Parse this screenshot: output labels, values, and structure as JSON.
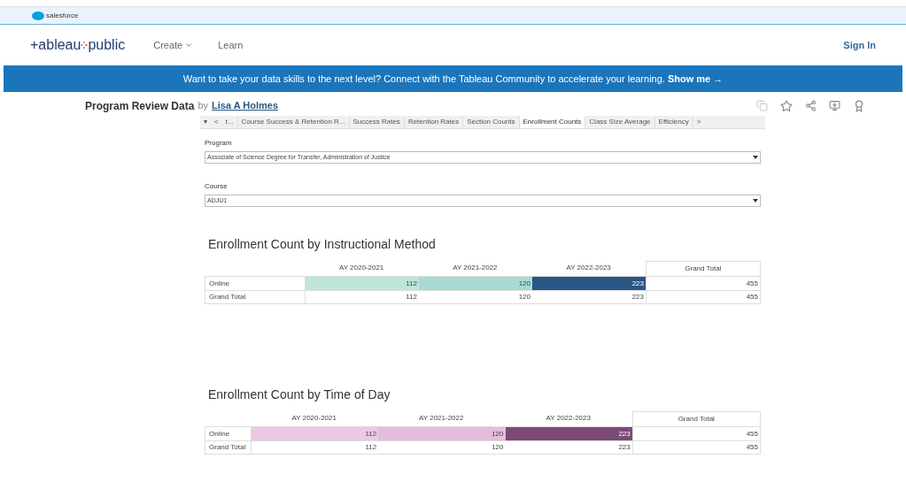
{
  "top_bar": {
    "brand": "salesforce"
  },
  "nav": {
    "logo_left": "+ableau",
    "logo_right": "public",
    "items": [
      {
        "label": "Create",
        "kind": "dropdown"
      },
      {
        "label": "Learn",
        "kind": "link"
      }
    ],
    "sign_in": "Sign In"
  },
  "banner": {
    "text": "Want to take your data skills to the next level? Connect with the Tableau Community to accelerate your learning.",
    "link": "Show me →"
  },
  "viz": {
    "title": "Program Review Data",
    "by": "by",
    "author": "Lisa A Holmes"
  },
  "tabs": [
    {
      "label": "▾",
      "selected": false,
      "kind": "control"
    },
    {
      "label": "<",
      "selected": false,
      "kind": "control"
    },
    {
      "label": "t...",
      "selected": false,
      "kind": "tab"
    },
    {
      "label": "Course Success & Retention R...",
      "selected": false,
      "kind": "tab"
    },
    {
      "label": "Success Rates",
      "selected": false,
      "kind": "tab"
    },
    {
      "label": "Retention Rates",
      "selected": false,
      "kind": "tab"
    },
    {
      "label": "Section Counts",
      "selected": false,
      "kind": "tab"
    },
    {
      "label": "Enrollment Counts",
      "selected": true,
      "kind": "tab"
    },
    {
      "label": "Class Size Average",
      "selected": false,
      "kind": "tab"
    },
    {
      "label": "Efficiency",
      "selected": false,
      "kind": "tab"
    },
    {
      "label": ">",
      "selected": false,
      "kind": "control"
    }
  ],
  "filters": [
    {
      "label": "Program",
      "value": "Associate of Science Degree for Transfer, Administration of Justice"
    },
    {
      "label": "Course",
      "value": "ADJU1"
    }
  ],
  "tables": [
    {
      "title": "Enrollment Count by Instructional Method",
      "columns": [
        "AY 2020-2021",
        "AY 2021-2022",
        "AY 2022-2023",
        "Grand Total"
      ],
      "rows": [
        {
          "label": "Online",
          "cells": [
            {
              "text": "112",
              "color": "#bfe5da"
            },
            {
              "text": "120",
              "color": "#a8dad3"
            },
            {
              "text": "223",
              "color": "#2a5783"
            },
            {
              "text": "455"
            }
          ]
        },
        {
          "label": "Grand Total",
          "cells": [
            {
              "text": "112"
            },
            {
              "text": "120"
            },
            {
              "text": "223"
            },
            {
              "text": "455"
            }
          ]
        }
      ]
    },
    {
      "title": "Enrollment Count by Time of Day",
      "columns": [
        "AY 2020-2021",
        "AY 2021-2022",
        "AY 2022-2023",
        "Grand Total"
      ],
      "rows": [
        {
          "label": "Online",
          "cells": [
            {
              "text": "112",
              "color": "#ecc8e3"
            },
            {
              "text": "120",
              "color": "#e6bcdc"
            },
            {
              "text": "223",
              "color": "#7b4a77"
            },
            {
              "text": "455"
            }
          ]
        },
        {
          "label": "Grand Total",
          "cells": [
            {
              "text": "112"
            },
            {
              "text": "120"
            },
            {
              "text": "223"
            },
            {
              "text": "455"
            }
          ]
        }
      ]
    }
  ]
}
